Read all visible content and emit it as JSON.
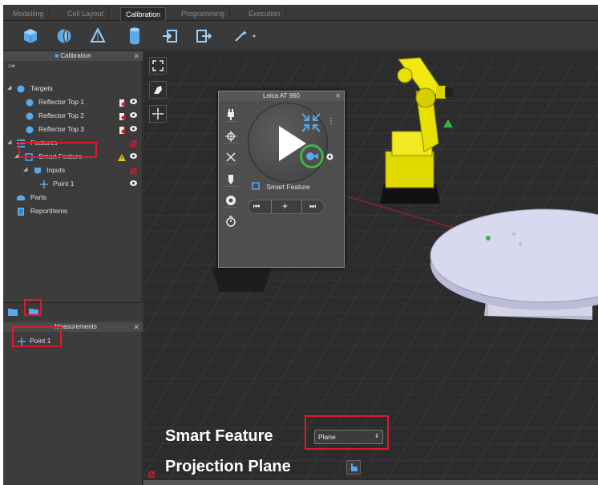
{
  "tabs": [
    {
      "label": "Modelling"
    },
    {
      "label": "Cell Layout"
    },
    {
      "label": "Calibration"
    },
    {
      "label": "Programming"
    },
    {
      "label": "Execution"
    }
  ],
  "calibration_panel": {
    "title": "Calibration",
    "tree": [
      {
        "label": "Targets"
      },
      {
        "label": "Reflector Top 1"
      },
      {
        "label": "Reflector Top 2"
      },
      {
        "label": "Reflector Top 3"
      },
      {
        "label": "Features"
      },
      {
        "label": "Smart Feature"
      },
      {
        "label": "Inputs"
      },
      {
        "label": "Point 1"
      },
      {
        "label": "Parts"
      },
      {
        "label": "ReportItems"
      }
    ]
  },
  "measurements_panel": {
    "title": "Measurements",
    "items": [
      {
        "label": "Point 1"
      }
    ]
  },
  "leica_panel": {
    "title": "Leica AT 960",
    "feature_label": "Smart Feature"
  },
  "overlay": {
    "smart_feature_label": "Smart Feature",
    "smart_feature_value": "Plane",
    "projection_plane_label": "Projection Plane"
  },
  "colors": {
    "highlight": "#e0182b",
    "robot": "#e8e000",
    "accent_green": "#3fb24a",
    "icon_blue": "#5aa9ea"
  }
}
